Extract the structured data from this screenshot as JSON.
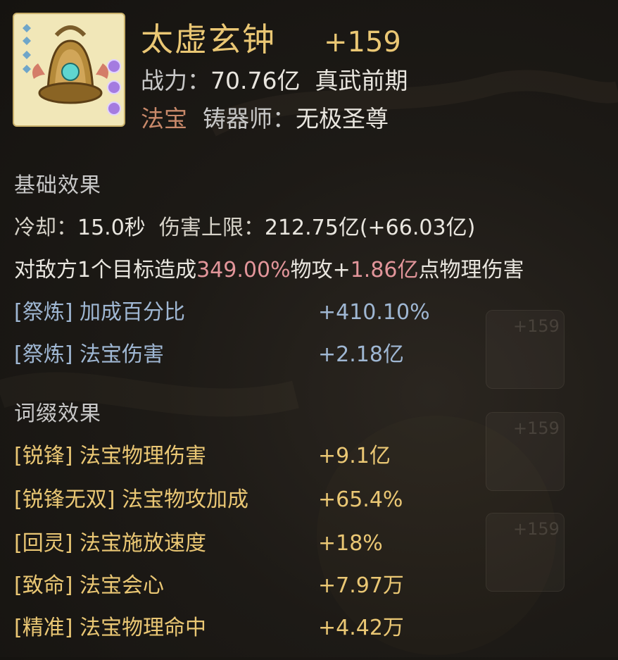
{
  "item": {
    "name": "太虚玄钟",
    "level": "+159",
    "power_label": "战力：",
    "power_value": "70.76亿",
    "realm": "真武前期",
    "type": "法宝",
    "maker_label": "铸器师：",
    "maker": "无极圣尊",
    "icon": "bell-icon"
  },
  "base": {
    "heading": "基础效果",
    "cooldown_label": "冷却：",
    "cooldown_value": "15.0秒",
    "cap_label": "伤害上限：",
    "cap_value": "212.75亿(+66.03亿)",
    "desc_prefix": "对敌方1个目标造成",
    "desc_pct": "349.00%",
    "desc_mid": "物攻+",
    "desc_flat": "1.86亿",
    "desc_suffix": "点物理伤害",
    "stats": [
      {
        "label": "[祭炼] 加成百分比",
        "value": "+410.10%"
      },
      {
        "label": "[祭炼] 法宝伤害",
        "value": "+2.18亿"
      }
    ]
  },
  "affix": {
    "heading": "词缀效果",
    "stats": [
      {
        "label": "[锐锋] 法宝物理伤害",
        "value": "+9.1亿"
      },
      {
        "label": "[锐锋无双] 法宝物攻加成",
        "value": "+65.4%"
      },
      {
        "label": "[回灵] 法宝施放速度",
        "value": "+18%"
      },
      {
        "label": "[致命] 法宝会心",
        "value": "+7.97万"
      },
      {
        "label": "[精准] 法宝物理命中",
        "value": "+4.42万"
      }
    ]
  },
  "background_items": [
    "+159",
    "+159",
    "+159"
  ],
  "colors": {
    "gold": "#eac774",
    "blue": "#9fb7d3",
    "pink": "#e2959a",
    "type": "#c9896a"
  }
}
